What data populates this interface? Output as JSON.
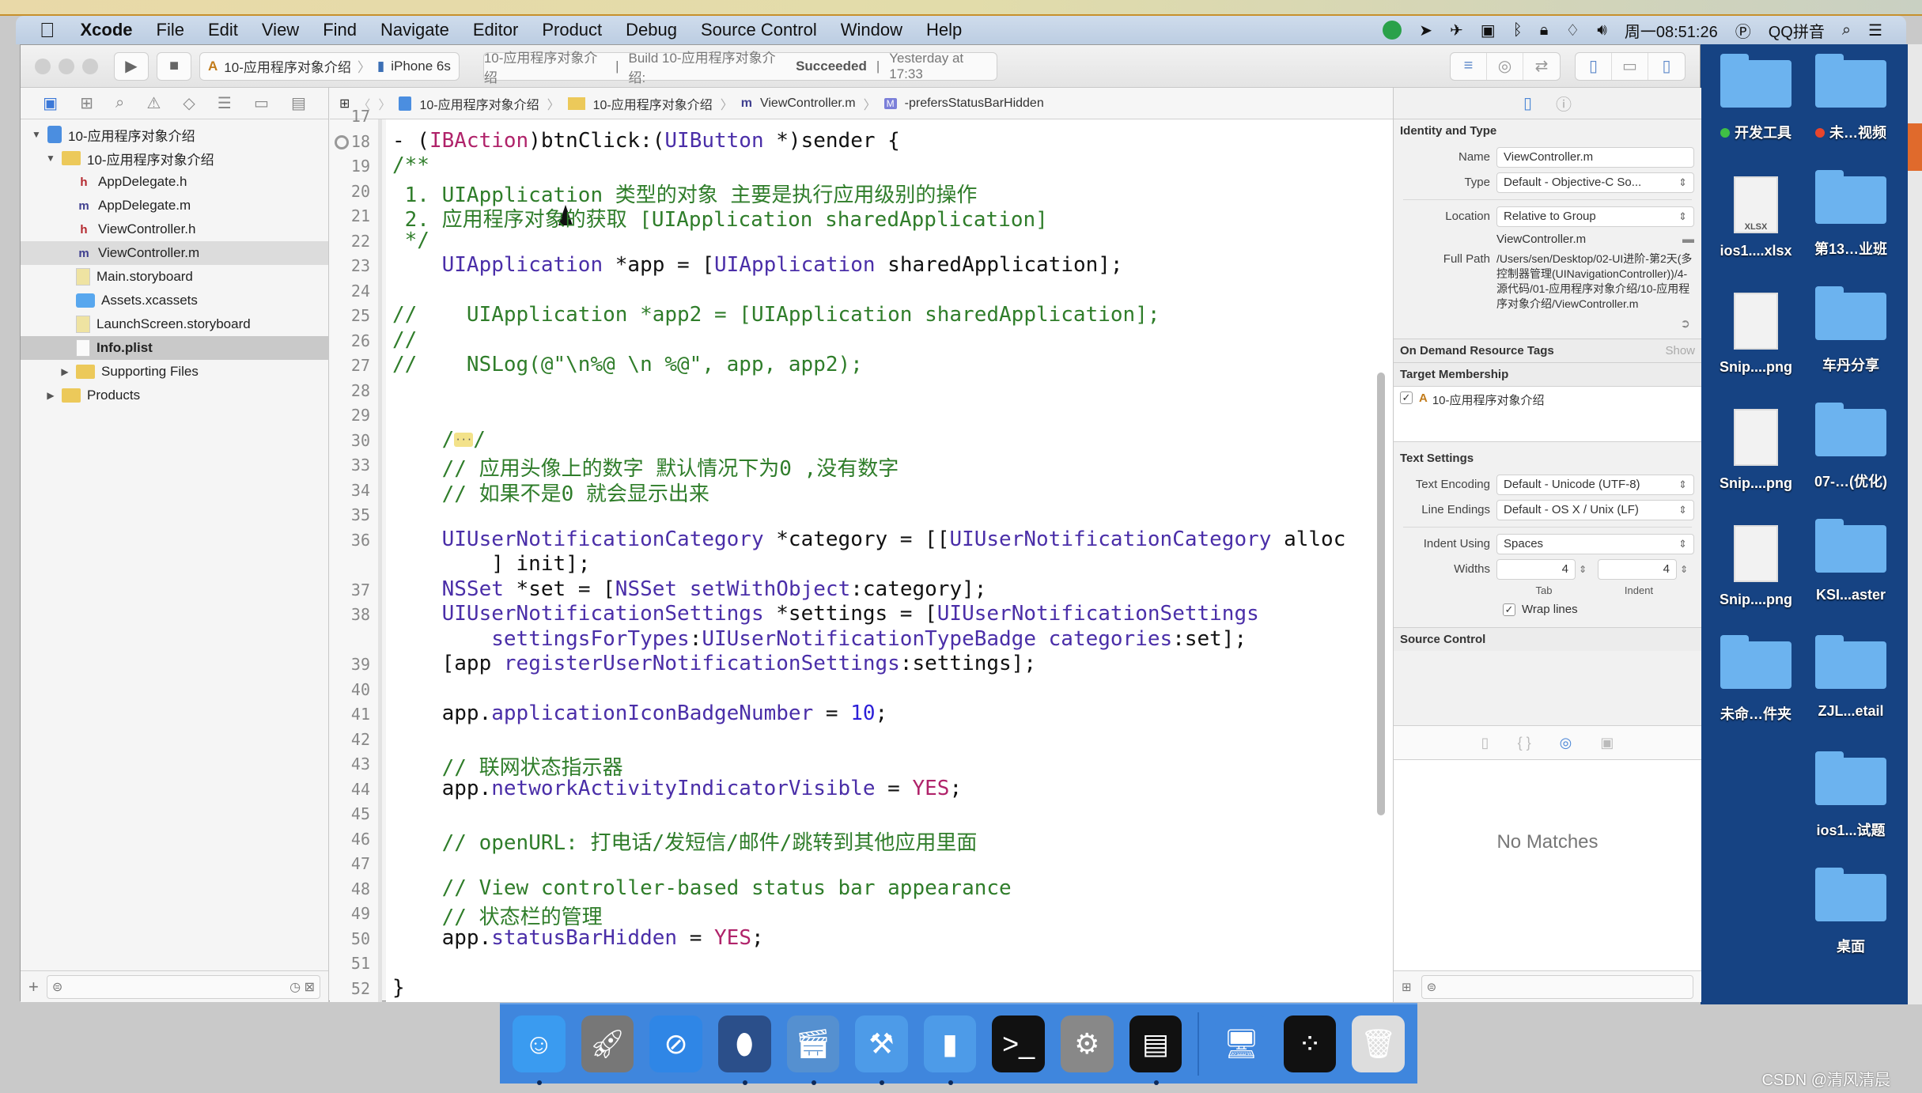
{
  "menubar": {
    "app_name": "Xcode",
    "items": [
      "File",
      "Edit",
      "View",
      "Find",
      "Navigate",
      "Editor",
      "Product",
      "Debug",
      "Source Control",
      "Window",
      "Help"
    ],
    "clock": "周一08:51:26",
    "input_method": "QQ拼音"
  },
  "toolbar": {
    "scheme_name": "10-应用程序对象介绍",
    "device": "iPhone 6s",
    "activity_project": "10-应用程序对象介绍",
    "activity_build": "Build 10-应用程序对象介绍:",
    "activity_status": "Succeeded",
    "activity_time": "Yesterday at 17:33"
  },
  "jumpbar": {
    "crumbs": [
      "10-应用程序对象介绍",
      "10-应用程序对象介绍",
      "ViewController.m",
      "-prefersStatusBarHidden"
    ]
  },
  "navigator": {
    "tree": [
      {
        "label": "10-应用程序对象介绍",
        "kind": "project",
        "level": 0,
        "expanded": true
      },
      {
        "label": "10-应用程序对象介绍",
        "kind": "folder",
        "level": 1,
        "expanded": true
      },
      {
        "label": "AppDelegate.h",
        "kind": "h",
        "level": 2
      },
      {
        "label": "AppDelegate.m",
        "kind": "m",
        "level": 2
      },
      {
        "label": "ViewController.h",
        "kind": "h",
        "level": 2
      },
      {
        "label": "ViewController.m",
        "kind": "m",
        "level": 2,
        "state": "highlighted"
      },
      {
        "label": "Main.storyboard",
        "kind": "storyboard",
        "level": 2
      },
      {
        "label": "Assets.xcassets",
        "kind": "assets",
        "level": 2
      },
      {
        "label": "LaunchScreen.storyboard",
        "kind": "storyboard",
        "level": 2
      },
      {
        "label": "Info.plist",
        "kind": "plist",
        "level": 2,
        "state": "selected"
      },
      {
        "label": "Supporting Files",
        "kind": "folder",
        "level": 2,
        "expanded": false
      },
      {
        "label": "Products",
        "kind": "folder",
        "level": 1,
        "expanded": false
      }
    ]
  },
  "editor": {
    "lines": [
      {
        "n": "17",
        "html": ""
      },
      {
        "n": "18",
        "bp": true,
        "html": "- (<span class='c-kw'>IBAction</span>)btnClick:(<span class='c-cls'>UIButton</span> *)sender {"
      },
      {
        "n": "19",
        "html": "<span class='c-com'>/**</span>"
      },
      {
        "n": "20",
        "html": "<span class='c-com'> 1. UIApplication 类型的对象 主要是执行应用级别的操作</span>"
      },
      {
        "n": "21",
        "html": "<span class='c-com'> 2. 应用程序对象的获取 [UIApplication sharedApplication]</span>"
      },
      {
        "n": "22",
        "html": "<span class='c-com'> */</span>"
      },
      {
        "n": "23",
        "html": "    <span class='c-cls'>UIApplication</span> *app = [<span class='c-cls'>UIApplication</span> sharedApplication];"
      },
      {
        "n": "24",
        "html": ""
      },
      {
        "n": "25",
        "html": "<span class='c-com'>//    UIApplication *app2 = [UIApplication sharedApplication];</span>"
      },
      {
        "n": "26",
        "html": "<span class='c-com'>//</span>"
      },
      {
        "n": "27",
        "html": "<span class='c-com'>//    NSLog(@\"\\n%@ \\n %@\", app, app2);</span>"
      },
      {
        "n": "28",
        "html": ""
      },
      {
        "n": "29",
        "html": ""
      },
      {
        "n": "30",
        "html": "    <span class='c-com'>/<span class='fold-chip'>···</span>/</span>"
      },
      {
        "n": "33",
        "html": "    <span class='c-com'>// 应用头像上的数字 默认情况下为0 ,没有数字</span>"
      },
      {
        "n": "34",
        "html": "    <span class='c-com'>// 如果不是0 就会显示出来</span>"
      },
      {
        "n": "35",
        "html": ""
      },
      {
        "n": "36",
        "html": "    <span class='c-cls'>UIUserNotificationCategory</span> *category = [[<span class='c-cls'>UIUserNotificationCategory</span> alloc"
      },
      {
        "n": "",
        "html": "        ] init];"
      },
      {
        "n": "37",
        "html": "    <span class='c-cls'>NSSet</span> *set = [<span class='c-cls'>NSSet</span> <span class='c-prop'>setWithObject</span>:category];"
      },
      {
        "n": "38",
        "html": "    <span class='c-cls'>UIUserNotificationSettings</span> *settings = [<span class='c-cls'>UIUserNotificationSettings</span>"
      },
      {
        "n": "",
        "html": "        <span class='c-prop'>settingsForTypes</span>:<span class='c-prop'>UIUserNotificationTypeBadge</span> <span class='c-prop'>categories</span>:set];"
      },
      {
        "n": "39",
        "html": "    [app <span class='c-prop'>registerUserNotificationSettings</span>:settings];"
      },
      {
        "n": "40",
        "html": ""
      },
      {
        "n": "41",
        "html": "    app.<span class='c-prop'>applicationIconBadgeNumber</span> = <span class='c-num'>10</span>;"
      },
      {
        "n": "42",
        "html": ""
      },
      {
        "n": "43",
        "html": "    <span class='c-com'>// 联网状态指示器</span>"
      },
      {
        "n": "44",
        "html": "    app.<span class='c-prop'>networkActivityIndicatorVisible</span> = <span class='c-kw'>YES</span>;"
      },
      {
        "n": "45",
        "html": ""
      },
      {
        "n": "46",
        "html": "    <span class='c-com'>// openURL: 打电话/发短信/邮件/跳转到其他应用里面</span>"
      },
      {
        "n": "47",
        "html": ""
      },
      {
        "n": "48",
        "html": "    <span class='c-com'>// View controller-based status bar appearance</span>"
      },
      {
        "n": "49",
        "html": "    <span class='c-com'>// 状态栏的管理</span>"
      },
      {
        "n": "50",
        "html": "    app.<span class='c-prop'>statusBarHidden</span> = <span class='c-kw'>YES</span>;"
      },
      {
        "n": "51",
        "html": ""
      },
      {
        "n": "52",
        "html": "}"
      }
    ]
  },
  "inspector": {
    "identity_title": "Identity and Type",
    "name_label": "Name",
    "name_value": "ViewController.m",
    "type_label": "Type",
    "type_value": "Default - Objective-C So...",
    "location_label": "Location",
    "location_value": "Relative to Group",
    "relative_name": "ViewController.m",
    "full_path_label": "Full Path",
    "full_path_value": "/Users/sen/Desktop/02-UI进阶-第2天(多控制器管理(UINavigationController))/4-源代码/01-应用程序对象介绍/10-应用程序对象介绍/ViewController.m",
    "odr_title": "On Demand Resource Tags",
    "odr_show": "Show",
    "target_title": "Target Membership",
    "target_name": "10-应用程序对象介绍",
    "target_checked": true,
    "text_settings_title": "Text Settings",
    "encoding_label": "Text Encoding",
    "encoding_value": "Default - Unicode (UTF-8)",
    "line_endings_label": "Line Endings",
    "line_endings_value": "Default - OS X / Unix (LF)",
    "indent_using_label": "Indent Using",
    "indent_using_value": "Spaces",
    "widths_label": "Widths",
    "tab_width": "4",
    "indent_width": "4",
    "tab_caption": "Tab",
    "indent_caption": "Indent",
    "wrap_lines_label": "Wrap lines",
    "wrap_lines_checked": true,
    "source_control_title": "Source Control",
    "library_empty": "No Matches"
  },
  "desktop": {
    "items": [
      {
        "label": "开发工具",
        "kind": "folder",
        "tag": "#3fbf45"
      },
      {
        "label": "未…视频",
        "kind": "folder",
        "tag": "#e8452c"
      },
      {
        "label": "ios1....xlsx",
        "kind": "file",
        "badge": "XLSX"
      },
      {
        "label": "第13…业班",
        "kind": "folder"
      },
      {
        "label": "Snip....png",
        "kind": "file"
      },
      {
        "label": "车丹分享",
        "kind": "folder"
      },
      {
        "label": "Snip....png",
        "kind": "file"
      },
      {
        "label": "07-…(优化)",
        "kind": "folder"
      },
      {
        "label": "Snip....png",
        "kind": "file"
      },
      {
        "label": "KSI...aster",
        "kind": "folder"
      },
      {
        "label": "未命…件夹",
        "kind": "folder"
      },
      {
        "label": "ZJL...etail",
        "kind": "folder"
      },
      {
        "label": "ios1...试题",
        "kind": "folder"
      },
      {
        "label": "桌面",
        "kind": "folder"
      }
    ]
  },
  "dock": {
    "apps": [
      {
        "name": "Finder",
        "icon": "finder-icon",
        "running": true
      },
      {
        "name": "Launchpad",
        "icon": "launchpad-icon",
        "running": false
      },
      {
        "name": "Safari",
        "icon": "safari-icon",
        "running": false
      },
      {
        "name": "Mouse",
        "icon": "mouse-icon",
        "running": true
      },
      {
        "name": "Video Recorder",
        "icon": "film-icon",
        "running": true
      },
      {
        "name": "Xcode",
        "icon": "xcode-icon",
        "running": true
      },
      {
        "name": "Simulator",
        "icon": "simulator-icon",
        "running": true
      },
      {
        "name": "Terminal",
        "icon": "terminal-icon",
        "running": false
      },
      {
        "name": "System Preferences",
        "icon": "gear-icon",
        "running": false
      },
      {
        "name": "Console",
        "icon": "console-icon",
        "running": true
      }
    ],
    "others": [
      {
        "name": "Desktop Stack",
        "icon": "desktop-stack-icon"
      },
      {
        "name": "Apps Stack",
        "icon": "apps-stack-icon"
      },
      {
        "name": "Trash",
        "icon": "trash-icon"
      }
    ]
  },
  "watermark": "CSDN @清风清晨"
}
